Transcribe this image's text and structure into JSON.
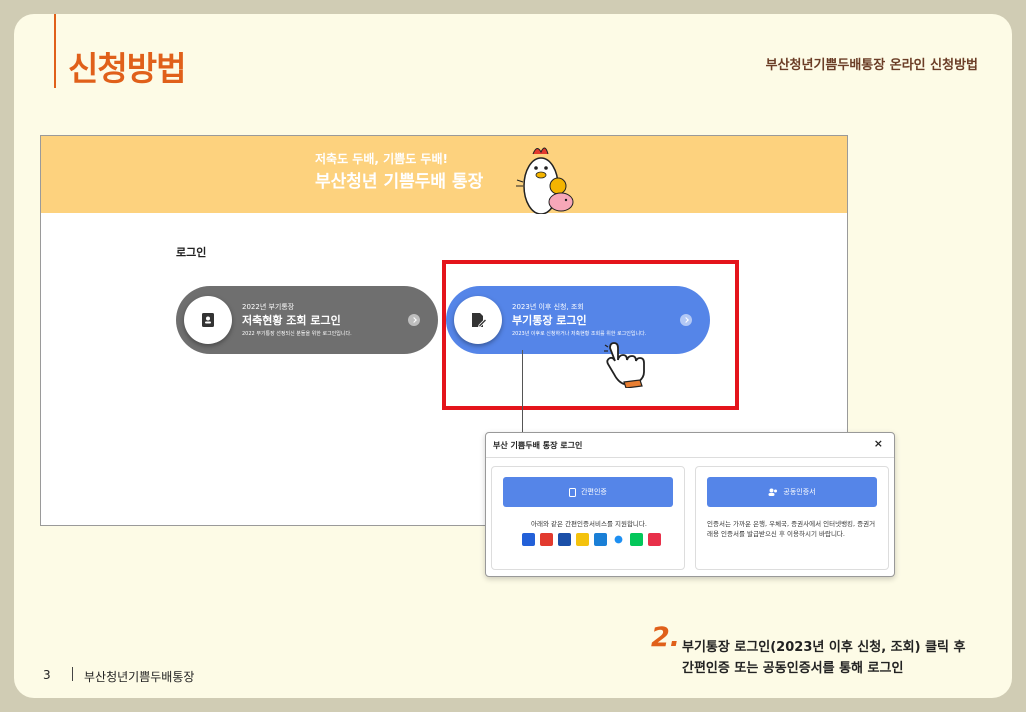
{
  "header": {
    "title": "신청방법",
    "right_text": "부산청년기쁨두배통장 온라인 신청방법"
  },
  "screenshot": {
    "banner": {
      "subtitle": "저축도 두배, 기쁨도 두배!",
      "title": "부산청년 기쁨두배 통장"
    },
    "login_label": "로그인",
    "buttons": [
      {
        "sub": "2022년 부기통장",
        "main": "저축현황 조회 로그인",
        "desc": "2022 부기통장 선정되신 분들을 위한 로그인입니다."
      },
      {
        "sub": "2023년 이후 신청, 조회",
        "main": "부기통장 로그인",
        "desc": "2023년 이후로 신청하거나 저축현황 조회를 위한 로그인입니다."
      }
    ]
  },
  "modal": {
    "title": "부산 기쁨두배 통장 로그인",
    "close": "×",
    "simple_auth": {
      "label": "간편인증",
      "text": "아래와 같은 간편인증서비스를 지원합니다."
    },
    "public_cert": {
      "label": "공동인증서",
      "text": "인증서는 가까운 은행, 우체국, 증권사에서 인터넷뱅킹, 증권거래용 인증서를 발급받으신 후 이용하시기 바랍니다."
    },
    "provider_colors": [
      "#2360d8",
      "#e23a2e",
      "#1b4fa8",
      "#f4c20d",
      "#1a7fd6",
      "#1d8ff2",
      "#03c75a",
      "#e8304a"
    ]
  },
  "footer": {
    "page": "3",
    "text": "부산청년기쁨두배통장"
  },
  "step": {
    "number": "2.",
    "line1": "부기통장 로그인(2023년 이후 신청, 조회) 클릭 후",
    "line2": "간편인증 또는 공동인증서를 통해 로그인"
  },
  "colors": {
    "accent": "#e0601a",
    "banner": "#fdd27e",
    "blue": "#5585e8",
    "highlight": "#e4141b"
  }
}
